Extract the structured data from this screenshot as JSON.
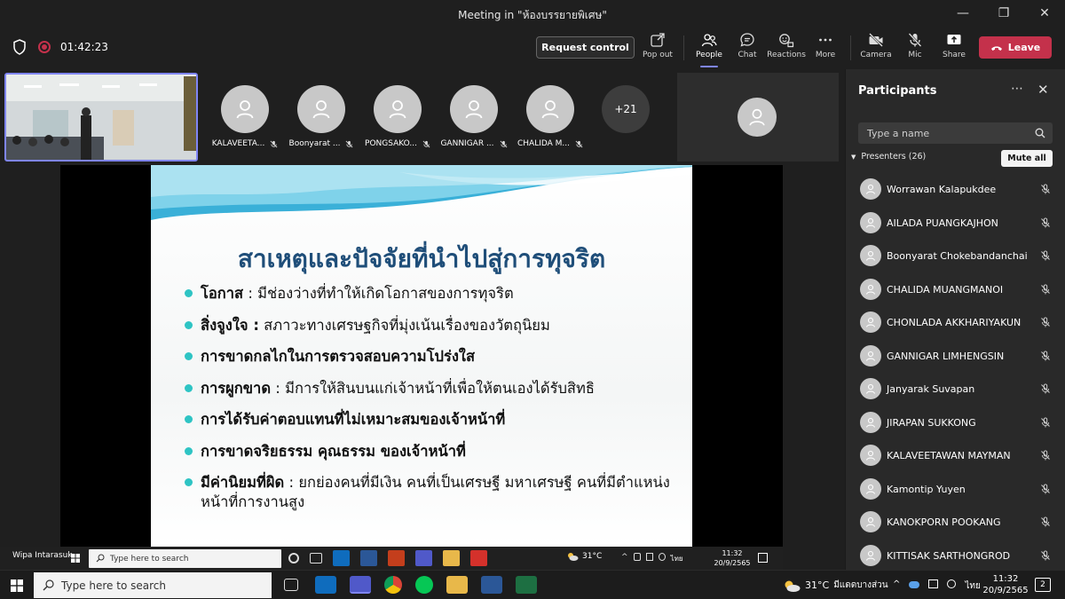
{
  "window": {
    "title": "Meeting in \"ห้องบรรยายพิเศษ\""
  },
  "meeting": {
    "timer": "01:42:23",
    "request_control": "Request control",
    "leave": "Leave"
  },
  "toolbar": [
    {
      "id": "popout",
      "label": "Pop out",
      "icon": "pop-out-icon"
    },
    {
      "id": "people",
      "label": "People",
      "icon": "people-icon",
      "active": true
    },
    {
      "id": "chat",
      "label": "Chat",
      "icon": "chat-icon"
    },
    {
      "id": "reactions",
      "label": "Reactions",
      "icon": "reactions-icon"
    },
    {
      "id": "more",
      "label": "More",
      "icon": "more-icon"
    },
    {
      "id": "camera",
      "label": "Camera",
      "icon": "camera-off-icon"
    },
    {
      "id": "mic",
      "label": "Mic",
      "icon": "mic-off-icon"
    },
    {
      "id": "share",
      "label": "Share",
      "icon": "share-icon"
    }
  ],
  "strip": {
    "tiles": [
      "KALAVEETA...",
      "Boonyarat ...",
      "PONGSAKO...",
      "GANNIGAR ...",
      "CHALIDA M..."
    ],
    "overflow": "+21"
  },
  "slide": {
    "title": "สาเหตุและปัจจัยที่นำไปสู่การทุจริต",
    "bullets": [
      {
        "head": "โอกาส",
        "text": " : มีช่องว่างที่ทำให้เกิดโอกาสของการทุจริต"
      },
      {
        "head": "สิ่งจูงใจ :",
        "text": "  สภาวะทางเศรษฐกิจที่มุ่งเน้นเรื่องของวัตถุนิยม"
      },
      {
        "head": "การขาดกลไกในการตรวจสอบความโปร่งใส",
        "text": ""
      },
      {
        "head": "การผูกขาด",
        "text": "  : มีการให้สินบนแก่เจ้าหน้าที่เพื่อให้ตนเองได้รับสิทธิ"
      },
      {
        "head": "การได้รับค่าตอบแทนที่ไม่เหมาะสมของเจ้าหน้าที่",
        "text": ""
      },
      {
        "head": "การขาดจริยธรรม คุณธรรม ของเจ้าหน้าที่",
        "text": ""
      },
      {
        "head": "มีค่านิยมที่ผิด",
        "text": " : ยกย่องคนที่มีเงิน คนที่เป็นเศรษฐี มหาเศรษฐี คนที่มีตำแหน่งหน้าที่การงานสูง"
      }
    ]
  },
  "shared_taskbar": {
    "presenter": "Wipa Intarasuk",
    "search": "Type here to search",
    "temp": "31°C",
    "lang": "ไทย",
    "time": "11:32",
    "date": "20/9/2565"
  },
  "panel": {
    "title": "Participants",
    "search_placeholder": "Type a name",
    "section": "Presenters (26)",
    "mute_all": "Mute all",
    "people": [
      "Worrawan Kalapukdee",
      "AILADA PUANGKAJHON",
      "Boonyarat Chokebandanchai",
      "CHALIDA MUANGMANOI",
      "CHONLADA AKKHARIYAKUN",
      "GANNIGAR LIMHENGSIN",
      "Janyarak Suvapan",
      "JIRAPAN SUKKONG",
      "KALAVEETAWAN MAYMAN",
      "Kamontip Yuyen",
      "KANOKPORN POOKANG",
      "KITTISAK SARTHONGROD"
    ]
  },
  "taskbar": {
    "search": "Type here to search",
    "weather": "31°C",
    "weather_desc": "มีแดดบางส่วน",
    "lang": "ไทย",
    "time": "11:32",
    "date": "20/9/2565",
    "notifications": "2"
  },
  "colors": {
    "accent": "#7f85f5",
    "leave": "#c4314b",
    "slide_title": "#1f4e79",
    "bullet": "#2ec4c4"
  }
}
